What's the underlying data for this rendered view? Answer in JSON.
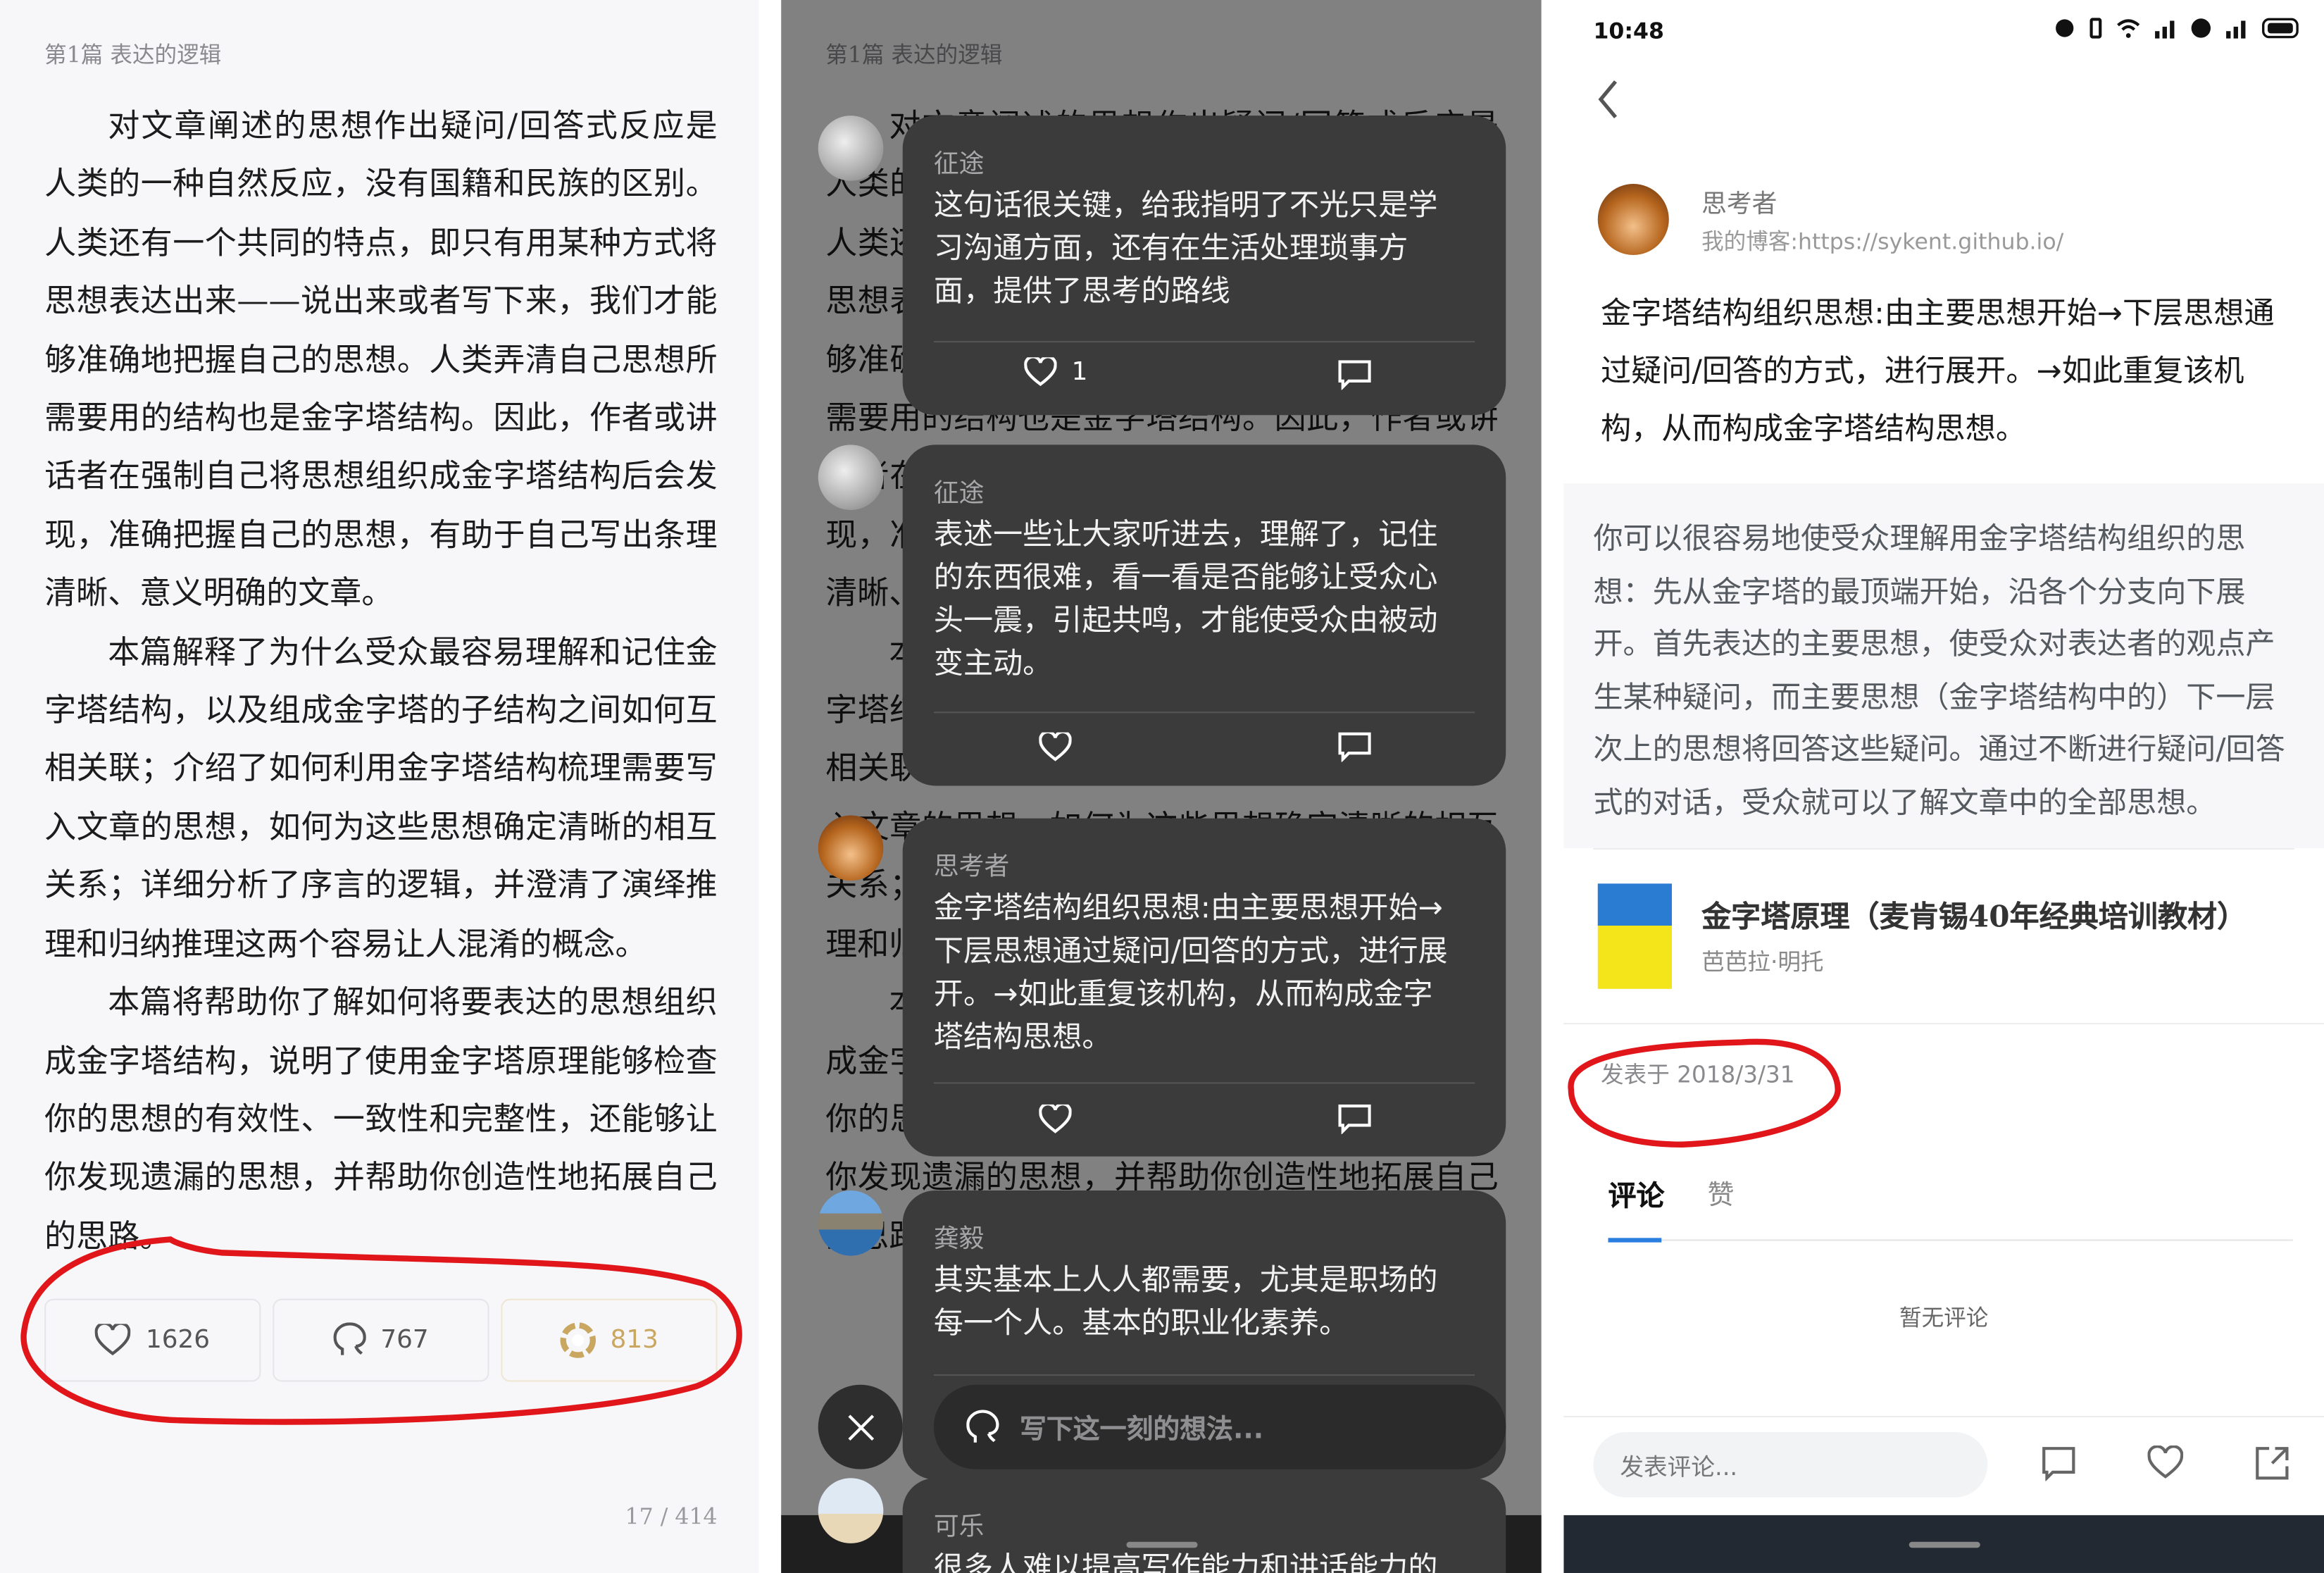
{
  "reader": {
    "chapter_title": "第1篇 表达的逻辑",
    "paragraphs": [
      "对文章阐述的思想作出疑问/回答式反应是人类的一种自然反应，没有国籍和民族的区别。人类还有一个共同的特点，即只有用某种方式将思想表达出来——说出来或者写下来，我们才能够准确地把握自己的思想。人类弄清自己思想所需要用的结构也是金字塔结构。因此，作者或讲话者在强制自己将思想组织成金字塔结构后会发现，准确把握自己的思想，有助于自己写出条理清晰、意义明确的文章。",
      "本篇解释了为什么受众最容易理解和记住金字塔结构，以及组成金字塔的子结构之间如何互相关联；介绍了如何利用金字塔结构梳理需要写入文章的思想，如何为这些思想确定清晰的相互关系；详细分析了序言的逻辑，并澄清了演绎推理和归纳推理这两个容易让人混淆的概念。",
      "本篇将帮助你了解如何将要表达的思想组织成金字塔结构，说明了使用金字塔原理能够检查你的思想的有效性、一致性和完整性，还能够让你发现遗漏的思想，并帮助你创造性地拓展自己的思路。"
    ],
    "actions": {
      "likes": "1626",
      "comments": "767",
      "shares": "813"
    },
    "page_indicator": "17 / 414",
    "annotation_color": "#e0161b",
    "share_color": "#c9a760"
  },
  "thoughts": {
    "cards": [
      {
        "user": "征途",
        "text": "这句话很关键，给我指明了不光只是学习沟通方面，还有在生活处理琐事方面，提供了思考的路线",
        "likes": "1"
      },
      {
        "user": "征途",
        "text": "表述一些让大家听进去，理解了，记住的东西很难，看一看是否能够让受众心头一震，引起共鸣，才能使受众由被动变主动。",
        "likes": ""
      },
      {
        "user": "思考者",
        "text": "金字塔结构组织思想:由主要思想开始→下层思想通过疑问/回答的方式，进行展开。→如此重复该机构，从而构成金字塔结构思想。",
        "likes": ""
      },
      {
        "user": "龚毅",
        "text": "其实基本上人人都需要，尤其是职场的每一个人。基本的职业化素养。",
        "likes": ""
      },
      {
        "user": "可乐",
        "text": "很多人难以提高写作能力和讲话能力的",
        "likes": ""
      }
    ],
    "input_placeholder": "写下这一刻的想法..."
  },
  "detail": {
    "status_time": "10:48",
    "status_icons": [
      "alarm-icon",
      "vibrate-icon",
      "wifi-icon",
      "4g-signal-icon",
      "hd-icon",
      "4g-signal-icon",
      "battery-icon"
    ],
    "author_name": "思考者",
    "author_blog": "我的博客:https://sykent.github.io/",
    "thought_text": "金字塔结构组织思想:由主要思想开始→下层思想通过疑问/回答的方式，进行展开。→如此重复该机构，从而构成金字塔结构思想。",
    "quote_text": "你可以很容易地使受众理解用金字塔结构组织的思想：先从金字塔的最顶端开始，沿各个分支向下展开。首先表达的主要思想，使受众对表达者的观点产生某种疑问，而主要思想（金字塔结构中的）下一层次上的思想将回答这些疑问。通过不断进行疑问/回答式的对话，受众就可以了解文章中的全部思想。",
    "book_title": "金字塔原理（麦肯锡40年经典培训教材）",
    "book_author": "芭芭拉·明托",
    "published": "发表于 2018/3/31",
    "tabs": [
      {
        "label": "评论",
        "active": true
      },
      {
        "label": "赞",
        "active": false
      }
    ],
    "empty_comments": "暂无评论",
    "comment_placeholder": "发表评论...",
    "accent_color": "#2a7ee0"
  }
}
